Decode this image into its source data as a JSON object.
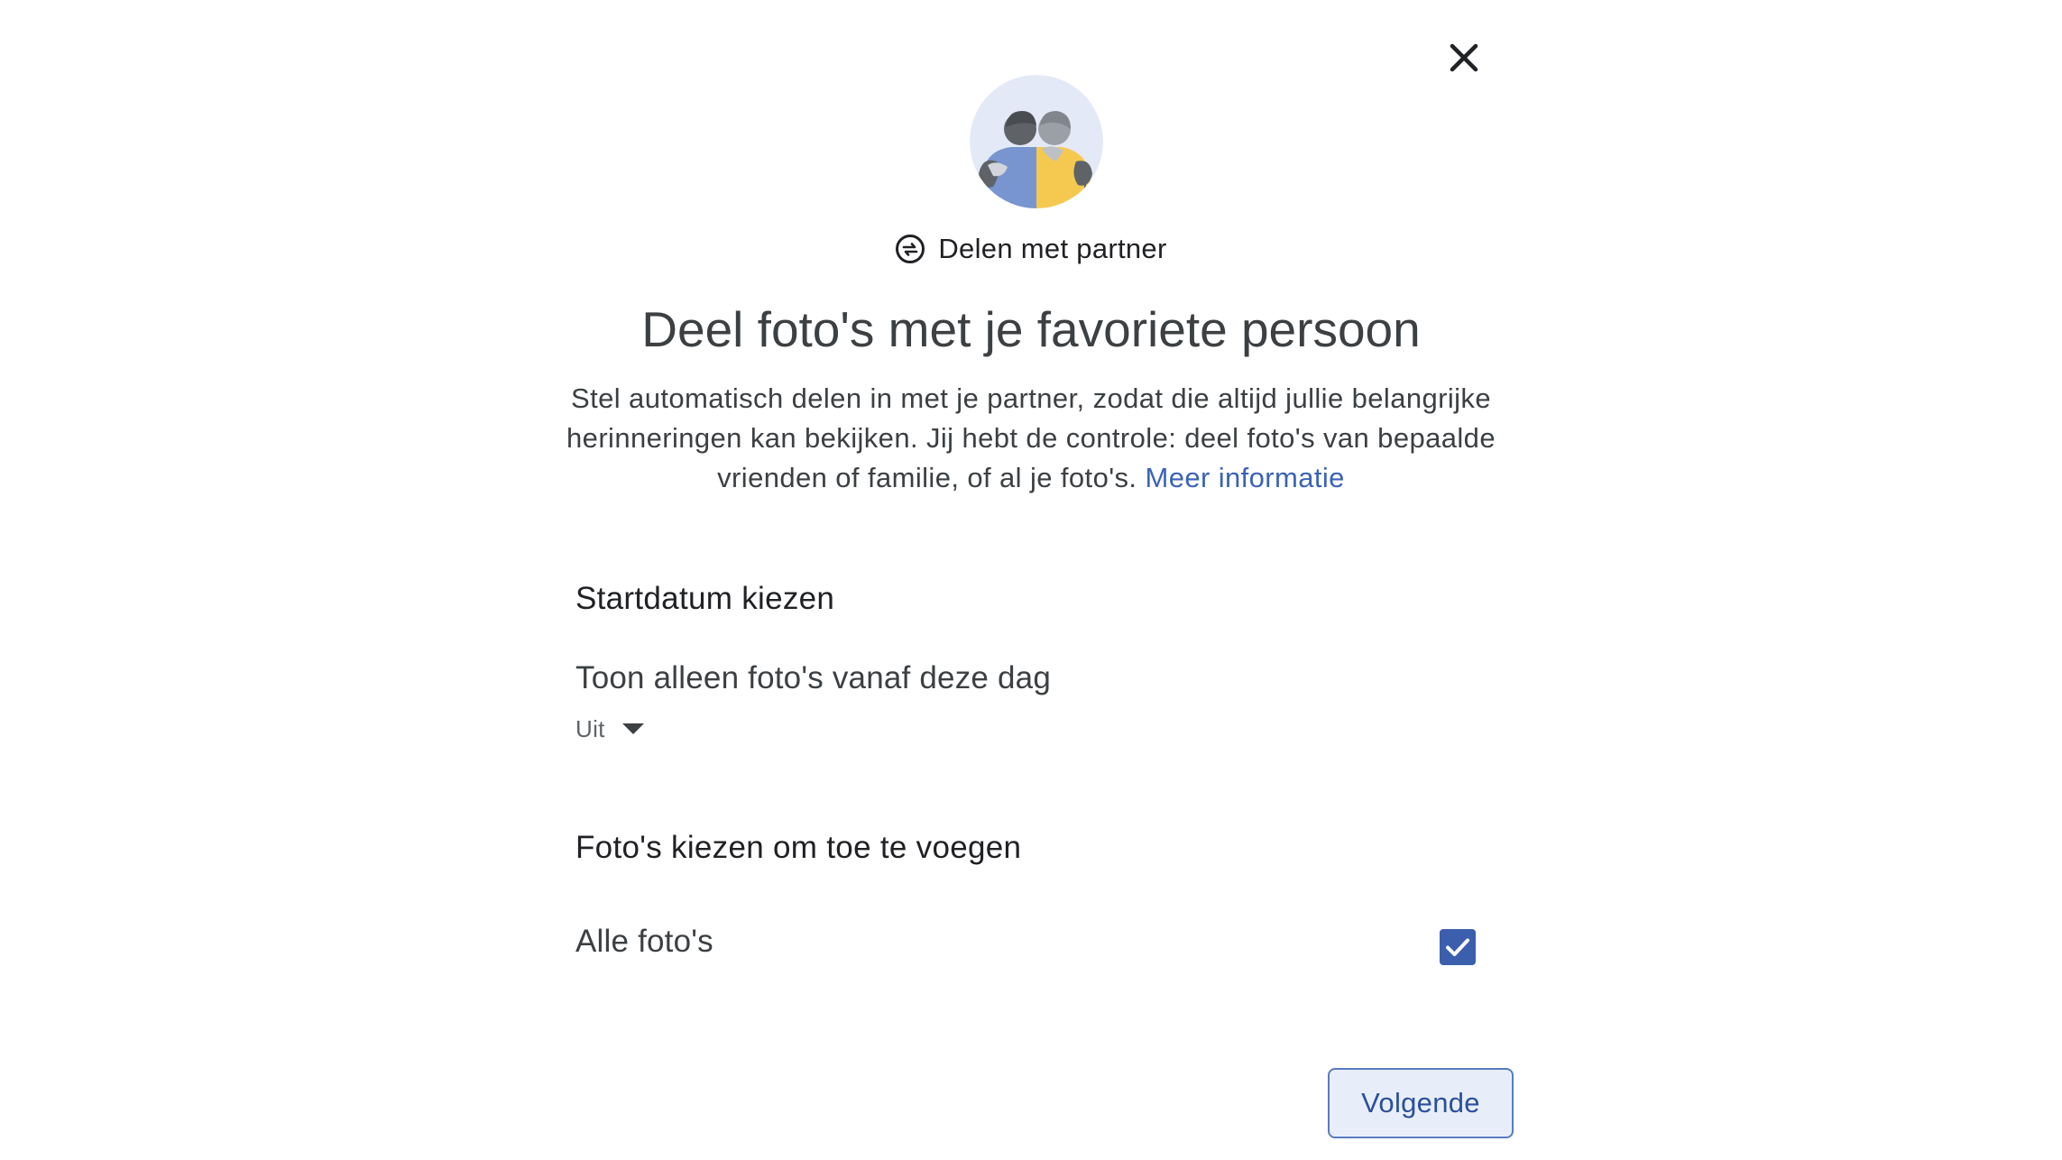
{
  "dialog": {
    "close_label": "close",
    "feature_label": "Delen met partner",
    "title": "Deel foto's met je favoriete persoon",
    "description": "Stel automatisch delen in met je partner, zodat die altijd jullie belangrijke herinneringen kan bekijken. Jij hebt de controle: deel foto's van bepaalde vrienden of familie, of al je foto's.",
    "learn_more_link": "Meer informatie"
  },
  "start_date": {
    "heading": "Startdatum kiezen",
    "label": "Toon alleen foto's vanaf deze dag",
    "selected_value": "Uit"
  },
  "photos": {
    "heading": "Foto's kiezen om toe te voegen",
    "option_label": "Alle foto's",
    "option_checked": true
  },
  "footer": {
    "next_button": "Volgende"
  },
  "colors": {
    "accent": "#3b5fad",
    "link": "#3b63b5",
    "button_bg": "#e8eef9",
    "illustration_bg": "#e3e9f6",
    "figure_blue": "#7895cf",
    "figure_yellow": "#f5c94f"
  },
  "icons": {
    "close": "close-icon",
    "feature": "partner-sharing-icon",
    "dropdown": "caret-down-icon",
    "checkbox": "check-icon"
  }
}
